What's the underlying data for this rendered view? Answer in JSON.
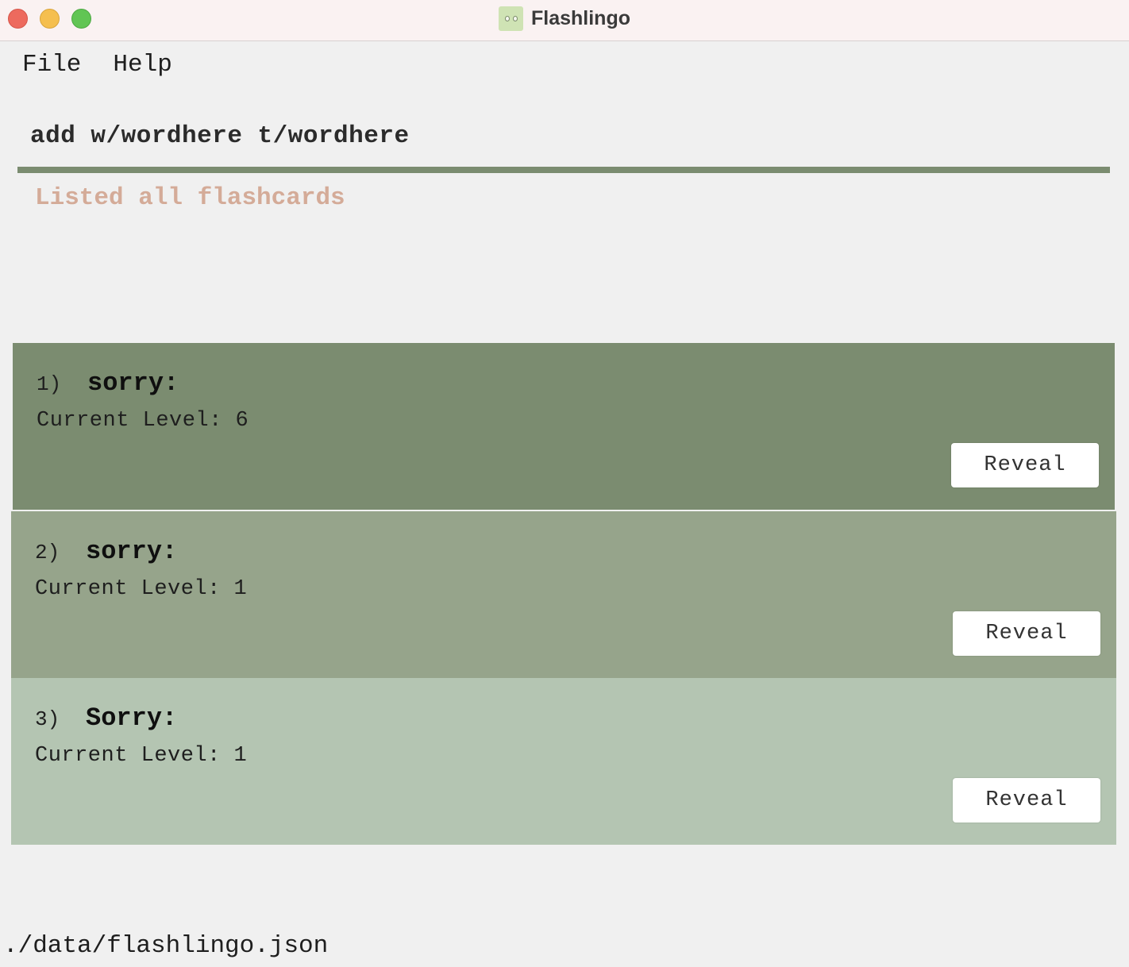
{
  "window": {
    "title": "Flashlingo",
    "icon": "app-logo-icon"
  },
  "menu": {
    "items": [
      {
        "label": "File"
      },
      {
        "label": "Help"
      }
    ]
  },
  "command": {
    "value": "add w/wordhere t/wordhere"
  },
  "result": {
    "message": "Listed all flashcards"
  },
  "flashcards": [
    {
      "index": "1)",
      "word": "sorry:",
      "level_text": "Current Level: 6",
      "button_label": "Reveal"
    },
    {
      "index": "2)",
      "word": "sorry:",
      "level_text": "Current Level: 1",
      "button_label": "Reveal"
    },
    {
      "index": "3)",
      "word": "Sorry:",
      "level_text": "Current Level: 1",
      "button_label": "Reveal"
    }
  ],
  "status_bar": {
    "file_path": "./data/flashlingo.json"
  },
  "colors": {
    "accent": "#7b8c70",
    "card_1": "#7b8c70",
    "card_2": "#96a48b",
    "card_3": "#b4c5b2",
    "result_text": "#d4ab98"
  }
}
